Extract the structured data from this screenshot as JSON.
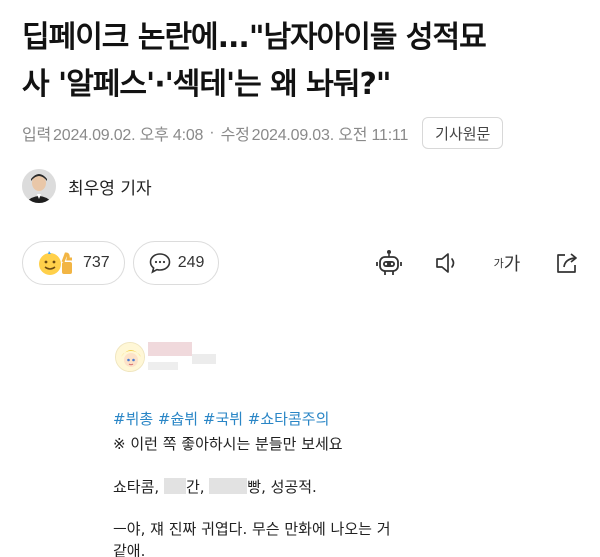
{
  "article": {
    "headline_line1": "딥페이크 논란에...\"남자아이돌 성적묘",
    "headline_line2": "사 '알페스'·'섹테'는 왜 놔둬?\"",
    "input_label": "입력",
    "input_time": "2024.09.02. 오후 4:08",
    "separator": "·",
    "modified_label": "수정",
    "modified_time": "2024.09.03. 오전 11:11",
    "original_button": "기사원문",
    "reporter": "최우영 기자"
  },
  "actions": {
    "reaction_count": "737",
    "comment_count": "249",
    "font_small": "가",
    "font_big": "가"
  },
  "post": {
    "hashtags": "#뷔총 #슙뷔 #국뷔 #쇼타콤주의",
    "notice": "※ 이런 쪽 좋아하시는 분들만 보세요",
    "line_a_1": "쇼타콤, ",
    "line_a_2": "간, ",
    "line_a_3": "빵, 성공적.",
    "line_b": "ㅡ야, 쟤 진짜 귀엽다. 무슨 만화에 나오는 거",
    "line_c": "같애."
  }
}
